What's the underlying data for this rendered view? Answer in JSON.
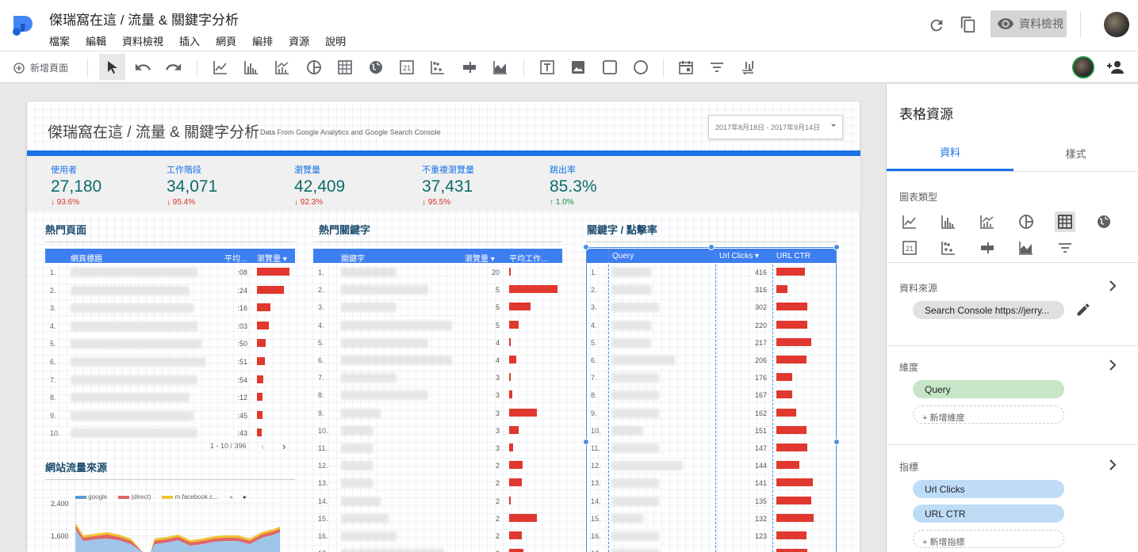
{
  "header": {
    "title": "傑瑞窩在這 / 流量 & 關鍵字分析",
    "menu": [
      "檔案",
      "編輯",
      "資料檢視",
      "插入",
      "網頁",
      "編排",
      "資源",
      "說明"
    ],
    "view_button": "資料檢視"
  },
  "toolbar": {
    "add_page": "新增頁面",
    "tools": [
      "select-icon",
      "undo-icon",
      "redo-icon",
      "line-chart-icon",
      "bar-chart-icon",
      "combo-chart-icon",
      "pie-chart-icon",
      "table-icon",
      "geo-map-icon",
      "scorecard-icon",
      "scatter-chart-icon",
      "bullet-chart-icon",
      "area-chart-icon",
      "text-box-icon",
      "image-icon",
      "rectangle-icon",
      "circle-icon",
      "date-range-icon",
      "filter-icon",
      "data-control-icon"
    ]
  },
  "report": {
    "title": "傑瑞窩在這 / 流量 & 關鍵字分析",
    "subtitle": "Data From Google Analytics and Google Search Console",
    "date_range": "2017年8月18日 - 2017年9月14日",
    "scorecards": [
      {
        "label": "使用者",
        "value": "27,180",
        "delta": "93.6%",
        "dir": "down"
      },
      {
        "label": "工作階段",
        "value": "34,071",
        "delta": "95.4%",
        "dir": "down"
      },
      {
        "label": "瀏覽量",
        "value": "42,409",
        "delta": "92.3%",
        "dir": "down"
      },
      {
        "label": "不重複瀏覽量",
        "value": "37,431",
        "delta": "95.5%",
        "dir": "down"
      },
      {
        "label": "跳出率",
        "value": "85.3%",
        "delta": "1.0%",
        "dir": "up"
      }
    ],
    "top_pages": {
      "title": "熱門頁面",
      "headers": [
        "網頁標題",
        "平均...",
        "瀏覽量"
      ],
      "rows": [
        {
          "n": "1.",
          "avg": ":08",
          "bar": 1.0
        },
        {
          "n": "2.",
          "avg": ":24",
          "bar": 0.84
        },
        {
          "n": "3.",
          "avg": ":16",
          "bar": 0.42
        },
        {
          "n": "4.",
          "avg": ":03",
          "bar": 0.36
        },
        {
          "n": "5.",
          "avg": ":50",
          "bar": 0.27
        },
        {
          "n": "6.",
          "avg": ":51",
          "bar": 0.24
        },
        {
          "n": "7.",
          "avg": ":54",
          "bar": 0.2
        },
        {
          "n": "8.",
          "avg": ":12",
          "bar": 0.18
        },
        {
          "n": "9.",
          "avg": ":45",
          "bar": 0.16
        },
        {
          "n": "10.",
          "avg": ":43",
          "bar": 0.15
        }
      ],
      "pager": "1 - 10 / 396"
    },
    "top_keywords": {
      "title": "熱門關鍵字",
      "headers": [
        "關鍵字",
        "瀏覽量",
        "平均工作..."
      ],
      "rows": [
        {
          "n": "1.",
          "views": "20",
          "bar": 0.02
        },
        {
          "n": "2.",
          "views": "5",
          "bar": 1.0
        },
        {
          "n": "3.",
          "views": "5",
          "bar": 0.45
        },
        {
          "n": "4.",
          "views": "5",
          "bar": 0.2
        },
        {
          "n": "5.",
          "views": "4",
          "bar": 0.04
        },
        {
          "n": "6.",
          "views": "4",
          "bar": 0.14
        },
        {
          "n": "7.",
          "views": "3",
          "bar": 0.04
        },
        {
          "n": "8.",
          "views": "3",
          "bar": 0.06
        },
        {
          "n": "9.",
          "views": "3",
          "bar": 0.57
        },
        {
          "n": "10.",
          "views": "3",
          "bar": 0.2
        },
        {
          "n": "11.",
          "views": "3",
          "bar": 0.09
        },
        {
          "n": "12.",
          "views": "2",
          "bar": 0.28
        },
        {
          "n": "13.",
          "views": "2",
          "bar": 0.26
        },
        {
          "n": "14.",
          "views": "2",
          "bar": 0.02
        },
        {
          "n": "15.",
          "views": "2",
          "bar": 0.58
        },
        {
          "n": "16.",
          "views": "2",
          "bar": 0.26
        },
        {
          "n": "17.",
          "views": "2",
          "bar": 0.3
        }
      ]
    },
    "keyword_ctr": {
      "title": "關鍵字 / 點擊率",
      "headers": [
        "Query",
        "Url Clicks",
        "URL CTR"
      ],
      "rows": [
        {
          "n": "1.",
          "clicks": "416",
          "ctr": 0.55
        },
        {
          "n": "2.",
          "clicks": "316",
          "ctr": 0.22
        },
        {
          "n": "3.",
          "clicks": "302",
          "ctr": 0.6
        },
        {
          "n": "4.",
          "clicks": "220",
          "ctr": 0.6
        },
        {
          "n": "5.",
          "clicks": "217",
          "ctr": 0.68
        },
        {
          "n": "6.",
          "clicks": "206",
          "ctr": 0.58
        },
        {
          "n": "7.",
          "clicks": "176",
          "ctr": 0.3
        },
        {
          "n": "8.",
          "clicks": "167",
          "ctr": 0.3
        },
        {
          "n": "9.",
          "clicks": "162",
          "ctr": 0.38
        },
        {
          "n": "10.",
          "clicks": "151",
          "ctr": 0.58
        },
        {
          "n": "11.",
          "clicks": "147",
          "ctr": 0.6
        },
        {
          "n": "12.",
          "clicks": "144",
          "ctr": 0.45
        },
        {
          "n": "13.",
          "clicks": "141",
          "ctr": 0.7
        },
        {
          "n": "14.",
          "clicks": "135",
          "ctr": 0.68
        },
        {
          "n": "15.",
          "clicks": "132",
          "ctr": 0.73
        },
        {
          "n": "16.",
          "clicks": "123",
          "ctr": 0.58
        },
        {
          "n": "17.",
          "clicks": "",
          "ctr": 0.6
        }
      ]
    },
    "traffic_sources": {
      "title": "網站流量來源",
      "legend": [
        "google",
        "(direct)",
        "m.facebook.c..."
      ],
      "legend_colors": [
        "#5b9bd5",
        "#e06666",
        "#f1c232"
      ],
      "y_ticks": [
        "2,400",
        "1,600"
      ]
    }
  },
  "panel": {
    "title": "表格資源",
    "tabs": [
      "資料",
      "樣式"
    ],
    "chart_type_label": "圖表類型",
    "chart_types": [
      "line-chart-icon",
      "bar-chart-icon",
      "combo-chart-icon",
      "pie-chart-icon",
      "table-icon",
      "geo-map-icon",
      "scorecard-icon",
      "scatter-chart-icon",
      "bullet-chart-icon",
      "area-chart-icon",
      "pivot-table-icon"
    ],
    "data_source_label": "資料來源",
    "data_source": "Search Console https://jerry...",
    "dimension_label": "維度",
    "dimension": "Query",
    "add_dimension": "+ 新增維度",
    "metric_label": "指標",
    "metrics": [
      "Url Clicks",
      "URL CTR"
    ],
    "add_metric": "+ 新增指標"
  }
}
